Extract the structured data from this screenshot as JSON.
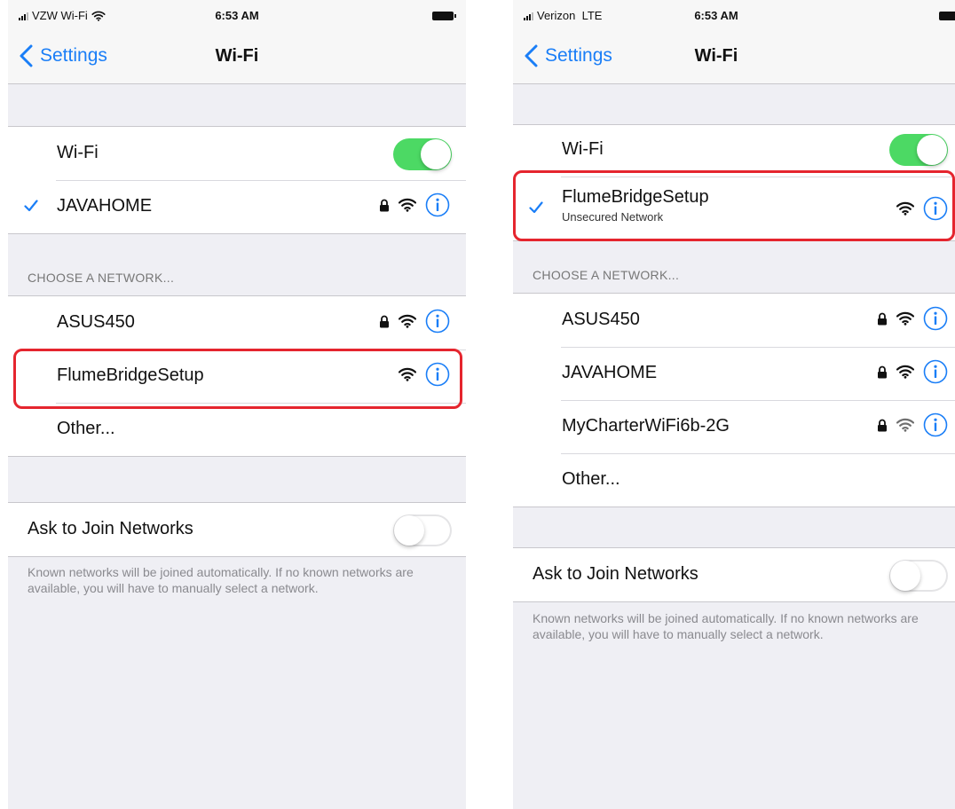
{
  "colors": {
    "accent": "#1a7ef7",
    "toggle_on": "#4cd964",
    "highlight": "#e5252e",
    "background": "#efeff4"
  },
  "screens": [
    {
      "status": {
        "carrier": "VZW Wi-Fi",
        "time": "6:53 AM"
      },
      "nav": {
        "back_label": "Settings",
        "title": "Wi-Fi"
      },
      "wifi_toggle": {
        "label": "Wi-Fi",
        "state": "on"
      },
      "connected": {
        "name": "JAVAHOME",
        "subtitle": "",
        "secured": true
      },
      "section_header": "CHOOSE A NETWORK...",
      "networks": [
        {
          "name": "ASUS450",
          "secured": true
        },
        {
          "name": "FlumeBridgeSetup",
          "secured": false,
          "highlighted": true
        }
      ],
      "other_label": "Other...",
      "ask_to_join": {
        "label": "Ask to Join Networks",
        "state": "off"
      },
      "footnote": "Known networks will be joined automatically. If no known networks are available, you will have to manually select a network."
    },
    {
      "status": {
        "carrier": "Verizon  LTE",
        "time": "6:53 AM"
      },
      "nav": {
        "back_label": "Settings",
        "title": "Wi-Fi"
      },
      "wifi_toggle": {
        "label": "Wi-Fi",
        "state": "on"
      },
      "connected": {
        "name": "FlumeBridgeSetup",
        "subtitle": "Unsecured Network",
        "secured": false,
        "highlighted": true
      },
      "section_header": "CHOOSE A NETWORK...",
      "networks": [
        {
          "name": "ASUS450",
          "secured": true
        },
        {
          "name": "JAVAHOME",
          "secured": true
        },
        {
          "name": "MyCharterWiFi6b-2G",
          "secured": true
        }
      ],
      "other_label": "Other...",
      "ask_to_join": {
        "label": "Ask to Join Networks",
        "state": "off"
      },
      "footnote": "Known networks will be joined automatically. If no known networks are available, you will have to manually select a network."
    }
  ]
}
